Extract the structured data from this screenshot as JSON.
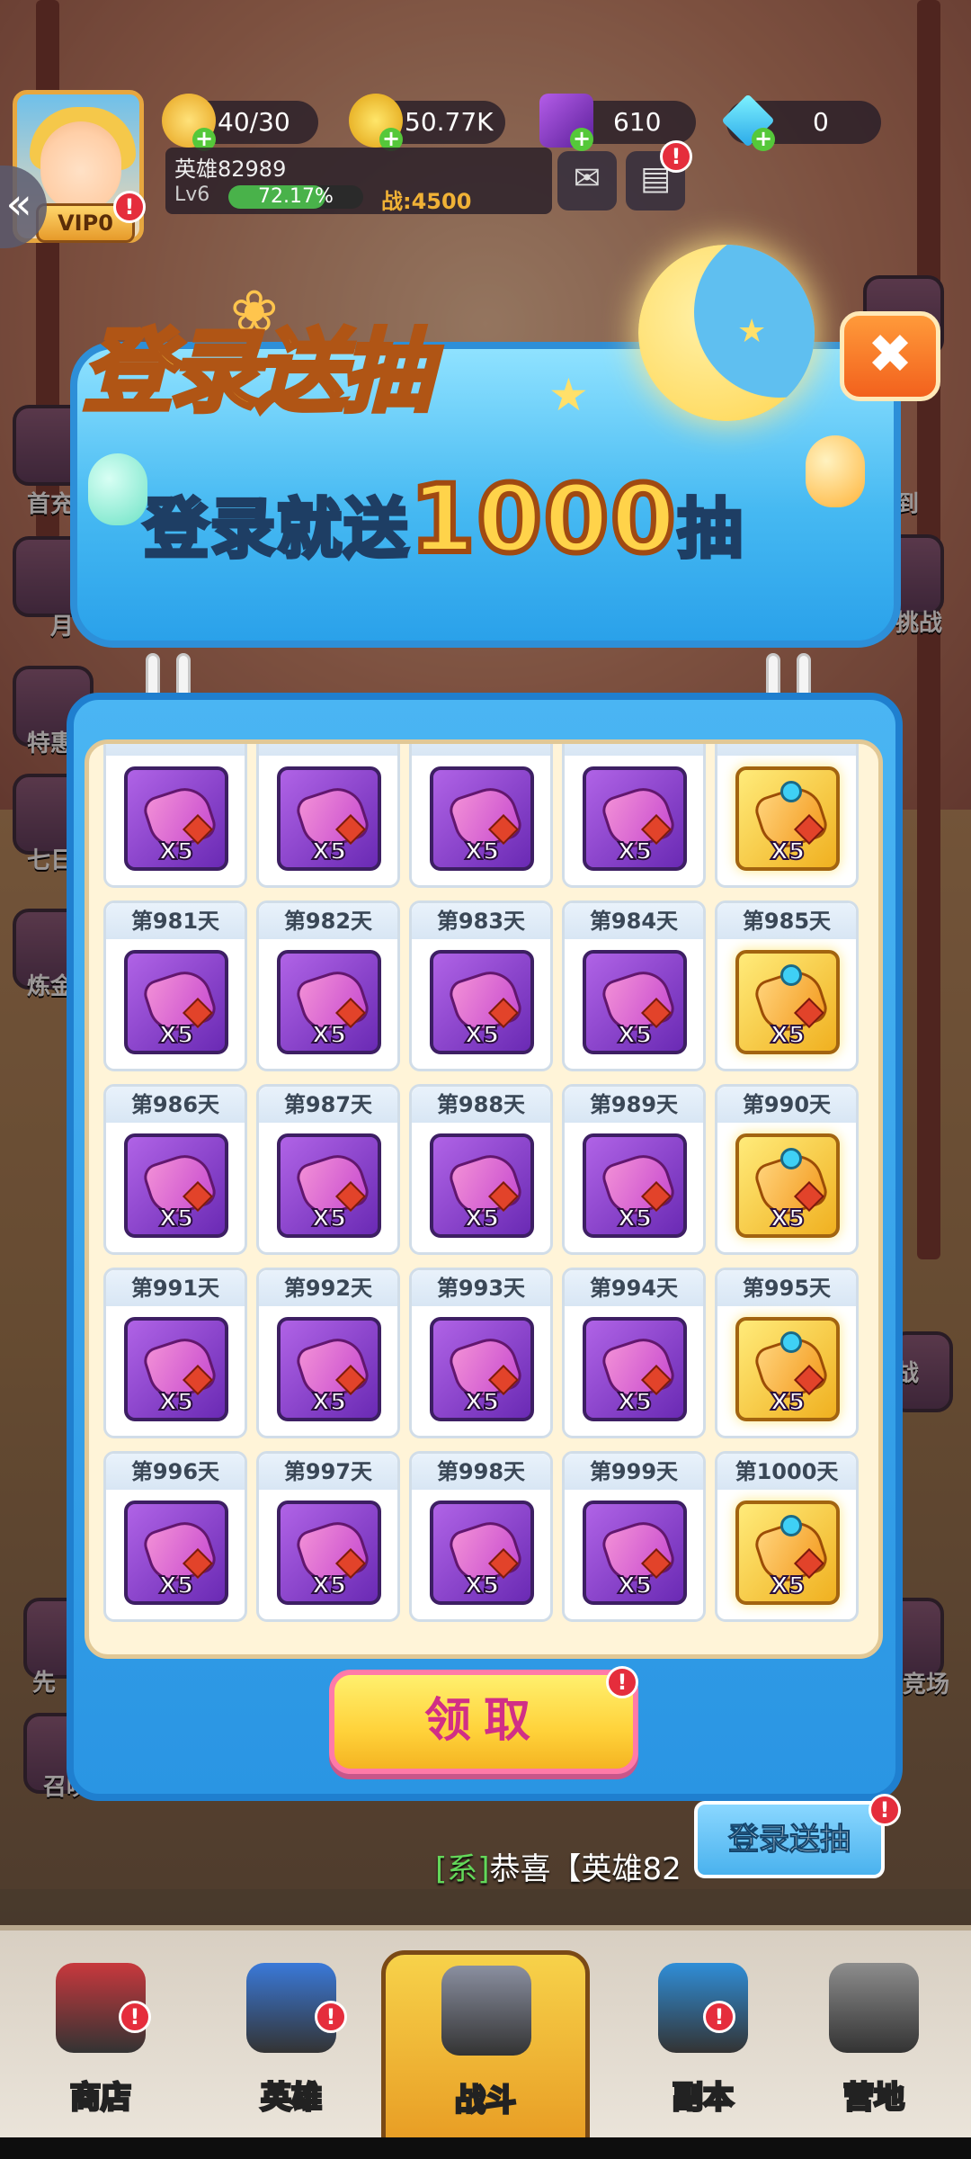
{
  "hud": {
    "stamina": "40/30",
    "gold": "50.77K",
    "cube": "610",
    "diamond": "0",
    "player_name": "英雄82989",
    "level": "Lv6",
    "xp_percent": "72.17%",
    "xp_fill_fraction": 0.7217,
    "power": "战:4500",
    "vip": "VIP0",
    "badge": "!"
  },
  "side_left": [
    "首充",
    "月",
    "特惠",
    "七日",
    "炼金",
    "先",
    "召唤"
  ],
  "side_right": [
    "到",
    "挑战",
    "战",
    "竞场"
  ],
  "popup": {
    "title_part1": "登录",
    "title_part2": "送抽",
    "subtitle_prefix": "登录就送",
    "subtitle_number": "1000",
    "subtitle_suffix": "抽",
    "close": "✖",
    "rows": [
      {
        "days": [
          "",
          "",
          "",
          "",
          ""
        ],
        "types": [
          "purple",
          "purple",
          "purple",
          "purple",
          "gold"
        ]
      },
      {
        "days": [
          "第981天",
          "第982天",
          "第983天",
          "第984天",
          "第985天"
        ],
        "types": [
          "purple",
          "purple",
          "purple",
          "purple",
          "gold"
        ]
      },
      {
        "days": [
          "第986天",
          "第987天",
          "第988天",
          "第989天",
          "第990天"
        ],
        "types": [
          "purple",
          "purple",
          "purple",
          "purple",
          "gold"
        ]
      },
      {
        "days": [
          "第991天",
          "第992天",
          "第993天",
          "第994天",
          "第995天"
        ],
        "types": [
          "purple",
          "purple",
          "purple",
          "purple",
          "gold"
        ]
      },
      {
        "days": [
          "第996天",
          "第997天",
          "第998天",
          "第999天",
          "第1000天"
        ],
        "types": [
          "purple",
          "purple",
          "purple",
          "purple",
          "gold"
        ]
      }
    ],
    "quantity": "X5",
    "claim_label": "领取"
  },
  "float_button": "登录送抽",
  "chat": {
    "sys": "[系]",
    "text": "恭喜【英雄82"
  },
  "nav": [
    {
      "label": "商店",
      "color": "#c8383d"
    },
    {
      "label": "英雄",
      "color": "#3a79d9"
    },
    {
      "label": "战斗",
      "color": "#8a8fa0"
    },
    {
      "label": "副本",
      "color": "#2f8ed8"
    },
    {
      "label": "营地",
      "color": "#8d8d8d"
    }
  ]
}
